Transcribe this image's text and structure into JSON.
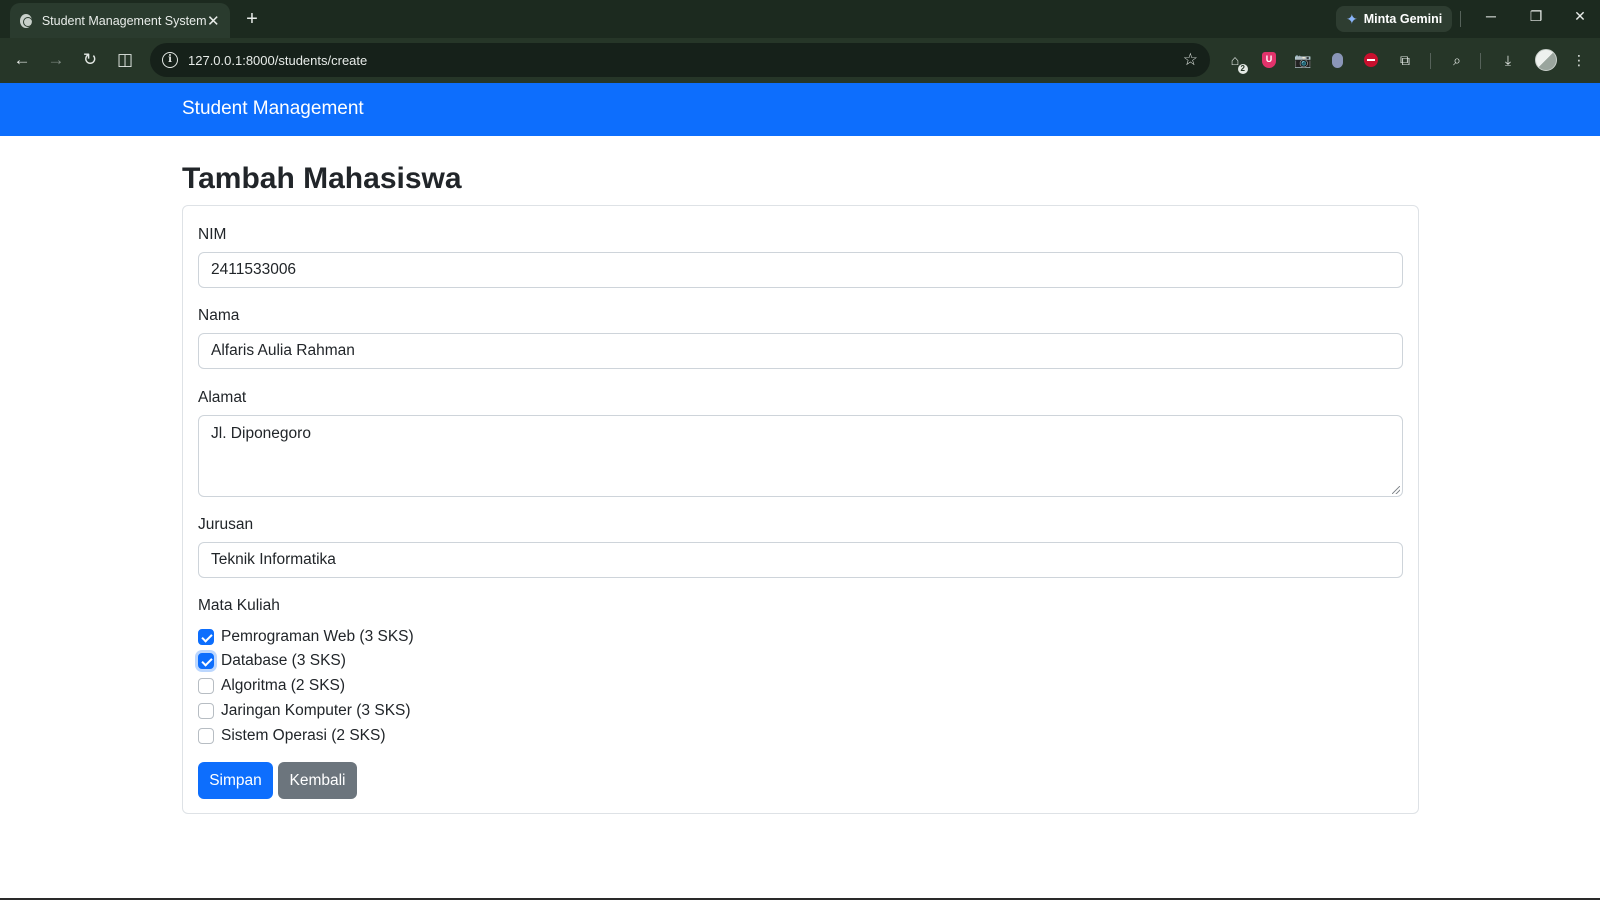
{
  "browser": {
    "tab_title": "Student Management System",
    "url": "127.0.0.1:8000/students/create",
    "gemini_label": "Minta Gemini",
    "ext_badge_count": "2",
    "ext_shield_letter": "U"
  },
  "navbar": {
    "brand": "Student Management"
  },
  "page": {
    "title": "Tambah Mahasiswa"
  },
  "form": {
    "nim_label": "NIM",
    "nim_value": "2411533006",
    "nama_label": "Nama",
    "nama_value": "Alfaris Aulia Rahman",
    "alamat_label": "Alamat",
    "alamat_value": "Jl. Diponegoro",
    "jurusan_label": "Jurusan",
    "jurusan_value": "Teknik Informatika",
    "mata_kuliah_label": "Mata Kuliah",
    "courses": [
      {
        "label": "Pemrograman Web (3 SKS)",
        "checked": true
      },
      {
        "label": "Database (3 SKS)",
        "checked": true
      },
      {
        "label": "Algoritma (2 SKS)",
        "checked": false
      },
      {
        "label": "Jaringan Komputer (3 SKS)",
        "checked": false
      },
      {
        "label": "Sistem Operasi (2 SKS)",
        "checked": false
      }
    ],
    "submit_label": "Simpan",
    "back_label": "Kembali"
  },
  "colors": {
    "primary": "#0d6efd",
    "secondary": "#6c757d",
    "text": "#212529"
  }
}
